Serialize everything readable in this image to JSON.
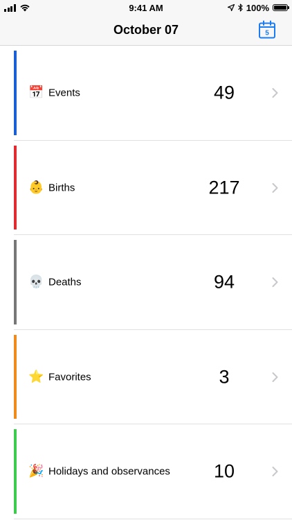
{
  "status_bar": {
    "time": "9:41 AM",
    "battery_percent": "100%",
    "battery_level": 1.0
  },
  "nav": {
    "title": "October 07",
    "calendar_icon": "calendar-icon",
    "calendar_icon_text": "5"
  },
  "categories": [
    {
      "label": "Events",
      "count": "49",
      "icon": "📅",
      "icon_name": "calendar-emoji-icon",
      "color": "#1a5fd6"
    },
    {
      "label": "Births",
      "count": "217",
      "icon": "👶",
      "icon_name": "baby-emoji-icon",
      "color": "#e02b31"
    },
    {
      "label": "Deaths",
      "count": "94",
      "icon": "💀",
      "icon_name": "skull-emoji-icon",
      "color": "#777777"
    },
    {
      "label": "Favorites",
      "count": "3",
      "icon": "⭐",
      "icon_name": "star-emoji-icon",
      "color": "#ef8a1d"
    },
    {
      "label": "Holidays and observances",
      "count": "10",
      "icon": "🎉",
      "icon_name": "party-popper-emoji-icon",
      "color": "#3ccb4d"
    }
  ],
  "colors": {
    "accent": "#1a7cf0",
    "chevron": "#c7c7cc"
  }
}
